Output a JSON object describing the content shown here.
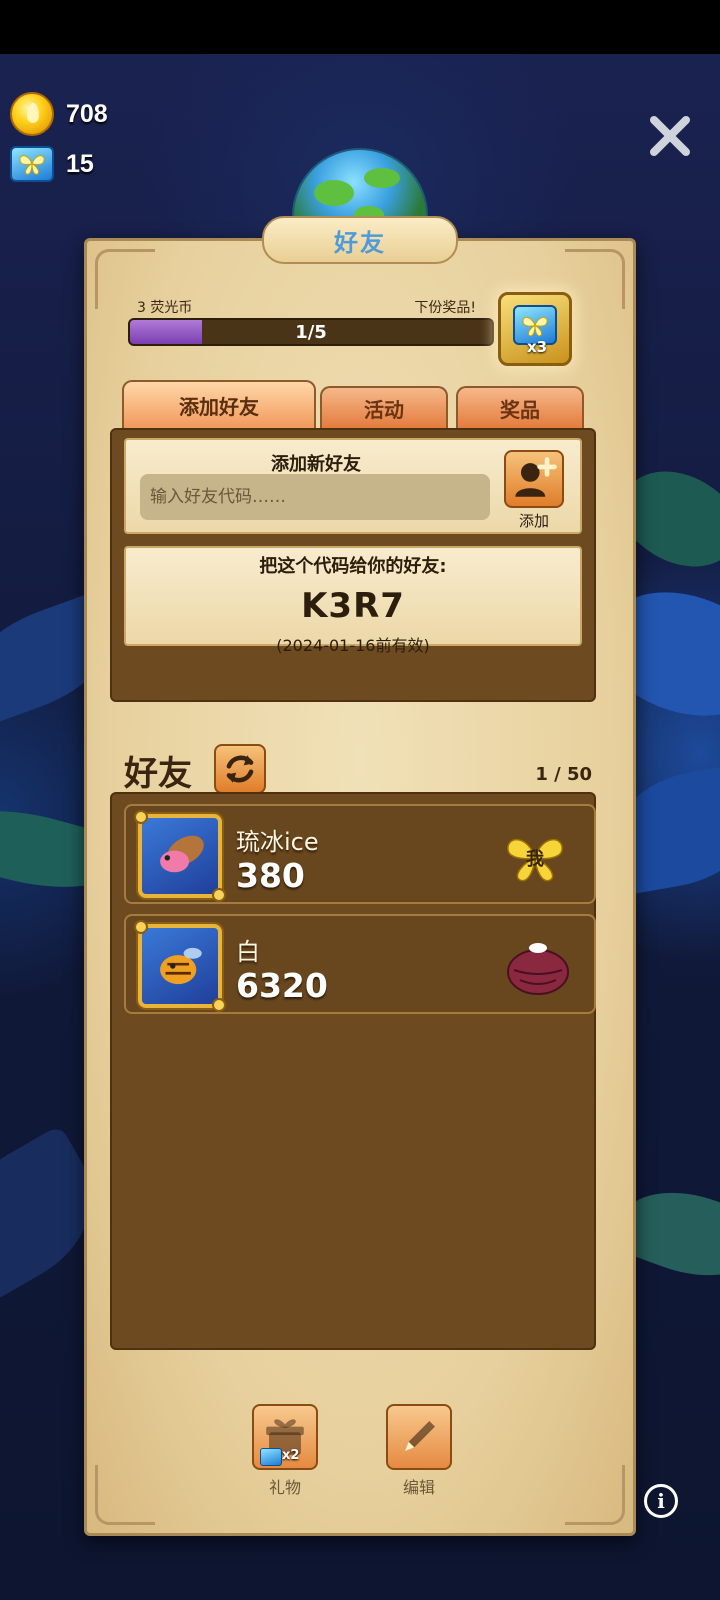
{
  "currencies": {
    "coins": "708",
    "gems": "15"
  },
  "header": {
    "title": "好友"
  },
  "progress": {
    "left_label": "3 荧光币",
    "right_label": "下份奖品!",
    "text": "1/5",
    "fraction": 0.2,
    "reward_multiplier": "x3"
  },
  "tabs": [
    {
      "label": "添加好友",
      "active": true
    },
    {
      "label": "活动",
      "active": false
    },
    {
      "label": "奖品",
      "active": false
    }
  ],
  "add_friend": {
    "title": "添加新好友",
    "placeholder": "输入好友代码……",
    "button_label": "添加"
  },
  "share": {
    "line": "把这个代码给你的好友:",
    "code": "K3R7",
    "expiry": "(2024-01-16前有效)"
  },
  "friends": {
    "title": "好友",
    "count": "1 / 50",
    "list": [
      {
        "name": "琉冰ice",
        "score": "380",
        "badge": "我"
      },
      {
        "name": "白",
        "score": "6320"
      }
    ]
  },
  "bottom": {
    "gift_label": "礼物",
    "gift_multiplier": "x2",
    "edit_label": "编辑"
  },
  "icons": {
    "coin": "coin-icon",
    "gem": "butterfly-gem-icon",
    "close": "close-icon",
    "info": "info-icon",
    "refresh": "refresh-icon",
    "add_person": "add-person-icon",
    "gift": "gift-icon",
    "edit": "pencil-icon"
  },
  "colors": {
    "panel": "#e7d09d",
    "progress_fill": "#7b3fb0",
    "tab_active": "#f19a5c",
    "friend_list_bg": "#6e4a20"
  }
}
